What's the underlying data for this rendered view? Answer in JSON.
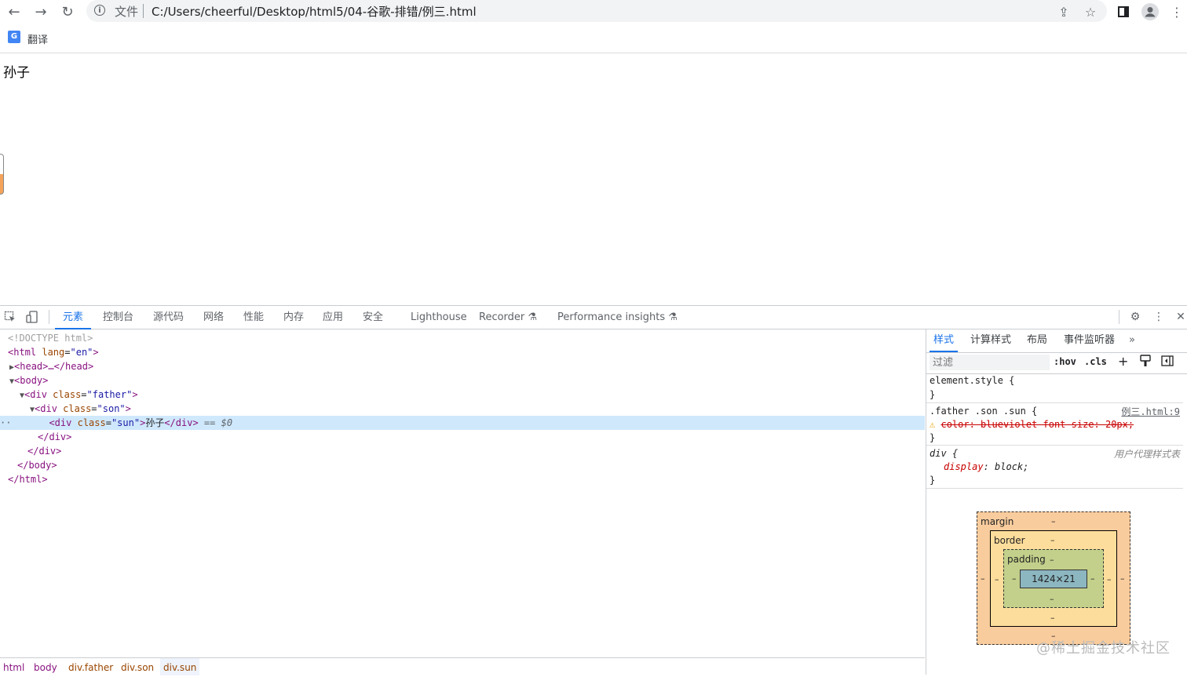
{
  "browser": {
    "omnibox": {
      "info_icon": "info-icon",
      "scheme_label": "文件",
      "url": "C:/Users/cheerful/Desktop/html5/04-谷歌-排错/例三.html"
    },
    "bookmarks": {
      "translate_label": "翻译"
    }
  },
  "page": {
    "text": "孙子"
  },
  "devtools": {
    "tabs": [
      "元素",
      "控制台",
      "源代码",
      "网络",
      "性能",
      "内存",
      "应用",
      "安全",
      "Lighthouse",
      "Recorder",
      "Performance insights"
    ],
    "active_tab": "元素",
    "tree": {
      "doctype": "<!DOCTYPE html>",
      "html_open": "<html",
      "html_attr": "lang",
      "html_val": "\"en\"",
      "head": "<head>…</head>",
      "body_open": "<body>",
      "father_open": "<div",
      "father_attr": "class",
      "father_val": "\"father\"",
      "son_open": "<div",
      "son_attr": "class",
      "son_val": "\"son\"",
      "sun_open": "<div",
      "sun_attr": "class",
      "sun_val": "\"sun\"",
      "sun_text": "孙子",
      "sun_close": "</div>",
      "selected_marker": "== $0",
      "son_close": "</div>",
      "father_close": "</div>",
      "body_close": "</body>",
      "html_close": "</html>"
    },
    "breadcrumbs": [
      "html",
      "body",
      "div.father",
      "div.son",
      "div.sun"
    ],
    "styles": {
      "tabs": [
        "样式",
        "计算样式",
        "布局",
        "事件监听器"
      ],
      "active_tab": "样式",
      "filter_placeholder": "过滤",
      "hov": ":hov",
      "cls": ".cls",
      "rules": {
        "element_style": "element.style {",
        "element_close": "}",
        "sun_selector": ".father .son .sun {",
        "sun_source": "例三.html:9",
        "sun_decl": "color: blueviolet font-size: 20px;",
        "sun_close": "}",
        "div_selector": "div {",
        "div_source": "用户代理样式表",
        "div_prop": "display",
        "div_value": ": block;",
        "div_close": "}"
      },
      "box_model": {
        "margin_label": "margin",
        "border_label": "border",
        "padding_label": "padding",
        "content_size": "1424×21",
        "dash": "–"
      }
    }
  },
  "watermark": "@稀土掘金技术社区",
  "colors": {
    "accent": "#1a73e8",
    "selected_row": "#cfe8fc",
    "margin": "#f9cc9d",
    "border": "#fddd9b",
    "padding": "#c3d08b",
    "content": "#8cb6c0"
  }
}
